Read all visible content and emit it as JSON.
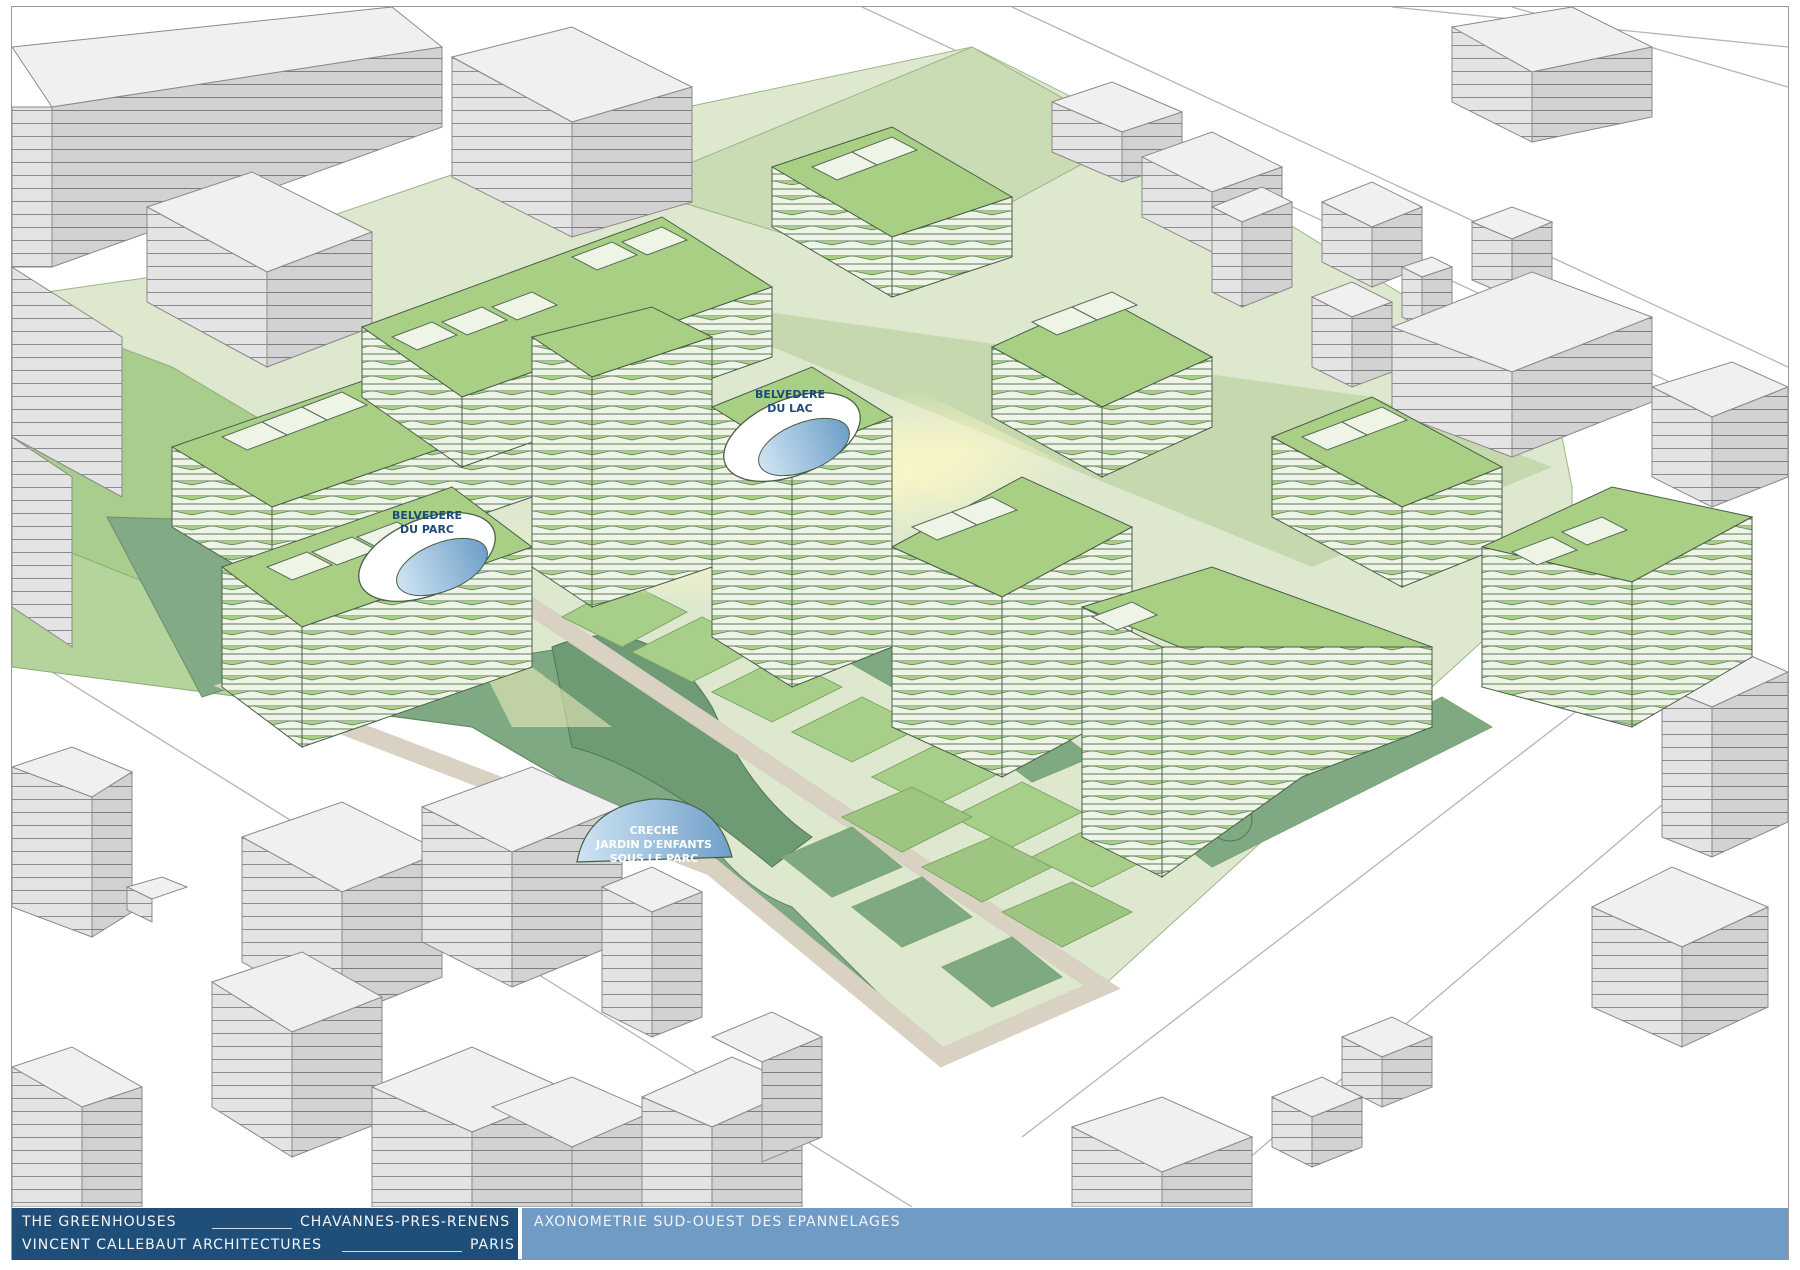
{
  "labels": {
    "belvedere_parc": [
      "BELVEDERE",
      "DU PARC"
    ],
    "belvedere_lac": [
      "BELVEDERE",
      "DU LAC"
    ],
    "creche": [
      "CRECHE",
      "JARDIN D'ENFANTS",
      "SOUS LE PARC"
    ]
  },
  "title_block": {
    "project": "THE GREENHOUSES",
    "location": "CHAVANNES-PRES-RENENS",
    "architect": "VINCENT CALLEBAUT ARCHITECTURES",
    "city": "PARIS",
    "drawing_title": "AXONOMETRIE SUD-OUEST DES EPANNELAGES"
  },
  "colors": {
    "light_green": "#b9d89a",
    "mid_green": "#9fc583",
    "dark_green": "#7fa983",
    "grey_building": "#e3e3e3",
    "path": "#e8e2d6",
    "title_dark": "#1f4f79",
    "title_light": "#6f9bc4"
  }
}
